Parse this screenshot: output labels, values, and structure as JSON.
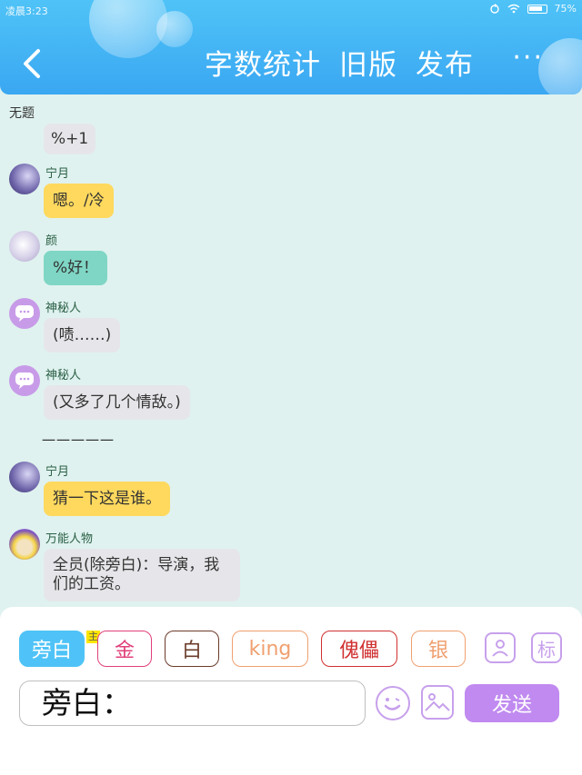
{
  "status": {
    "time": "凌晨3:23",
    "battery": "75%"
  },
  "header": {
    "title_parts": [
      "字数统计",
      "旧版",
      "发布"
    ],
    "more": "···"
  },
  "topic": "无题",
  "messages": [
    {
      "text": "%+1"
    },
    {
      "user": "宁月",
      "text": "嗯。/冷"
    },
    {
      "user": "颜",
      "text": "%好！"
    },
    {
      "user": "神秘人",
      "text": "(啧……)"
    },
    {
      "user": "神秘人",
      "text": "(又多了几个情敌。)"
    },
    {
      "divider": "一一一一一"
    },
    {
      "user": "宁月",
      "text": "猜一下这是谁。"
    },
    {
      "user": "万能人物",
      "text": "全员(除旁白)：导演，我们的工资。"
    }
  ],
  "roles": [
    {
      "label": "旁白",
      "color": "#4fc3f7",
      "active": true
    },
    {
      "label": "金",
      "color": "#e0407a"
    },
    {
      "label": "白",
      "color": "#6b3b2a"
    },
    {
      "label": "king",
      "color": "#f0a070"
    },
    {
      "label": "傀儡",
      "color": "#d03030"
    },
    {
      "label": "银",
      "color": "#f0a070"
    }
  ],
  "crown_badge": "主",
  "tools": {
    "tag_label": "标"
  },
  "input": {
    "value": "旁白："
  },
  "send_label": "发送"
}
